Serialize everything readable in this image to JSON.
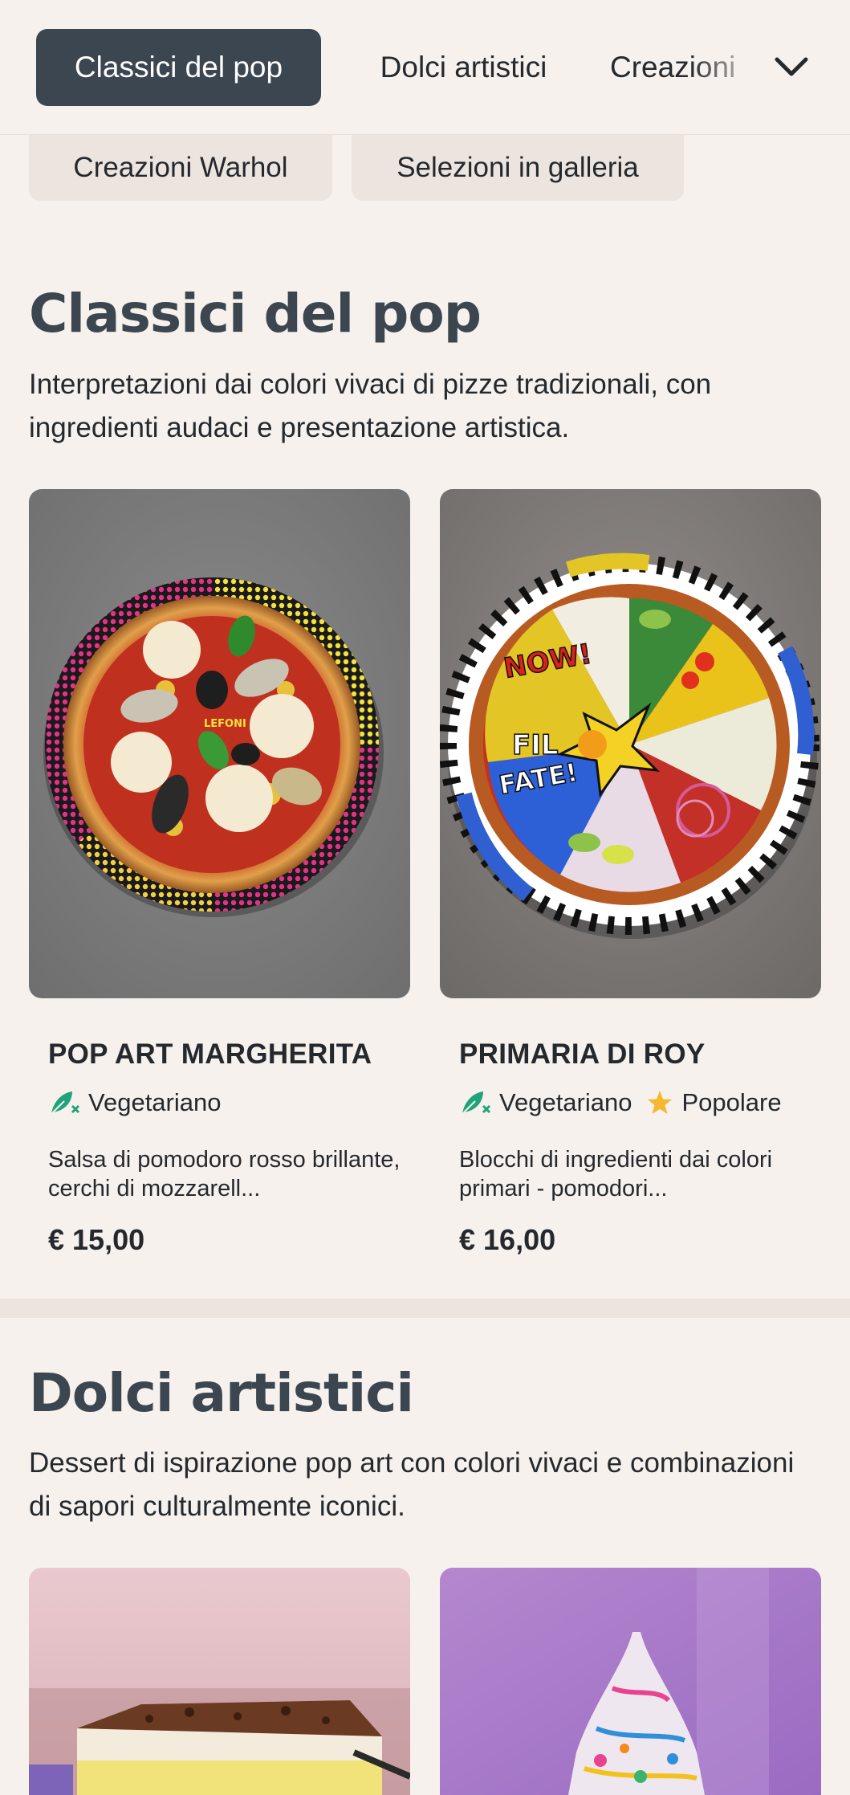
{
  "nav": {
    "tabs": [
      {
        "label": "Classici del pop",
        "active": true
      },
      {
        "label": "Dolci artistici",
        "active": false
      },
      {
        "label": "Creazioni",
        "active": false
      }
    ],
    "chips": [
      "Creazioni Warhol",
      "Selezioni in galleria"
    ],
    "more_icon": "chevron-down-icon"
  },
  "sections": [
    {
      "title": "Classici del pop",
      "description": "Interpretazioni dai colori vivaci di pizze tradizionali, con ingredienti audaci e presentazione artistica.",
      "items": [
        {
          "name": "POP ART MARGHERITA",
          "tags": [
            {
              "icon": "leaf-icon",
              "label": "Vegetariano"
            }
          ],
          "description": "Salsa di pomodoro rosso brillante, cerchi di mozzarell...",
          "price": "€ 15,00",
          "plate_text": "LEFONI"
        },
        {
          "name": "PRIMARIA DI ROY",
          "tags": [
            {
              "icon": "leaf-icon",
              "label": "Vegetariano"
            },
            {
              "icon": "star-icon",
              "label": "Popolare"
            }
          ],
          "description": "Blocchi di ingredienti dai colori primari - pomodori...",
          "price": "€ 16,00",
          "plate_text": [
            "NOW!",
            "FIL",
            "FATE!"
          ]
        }
      ]
    },
    {
      "title": "Dolci artistici",
      "description": "Dessert di ispirazione pop art con colori vivaci e combinazioni di sapori culturalmente iconici."
    }
  ],
  "colors": {
    "background": "#f6f1ec",
    "active_tab": "#3c4650",
    "heading": "#3c4650",
    "leaf": "#1fa37a",
    "star": "#f5b82e"
  }
}
